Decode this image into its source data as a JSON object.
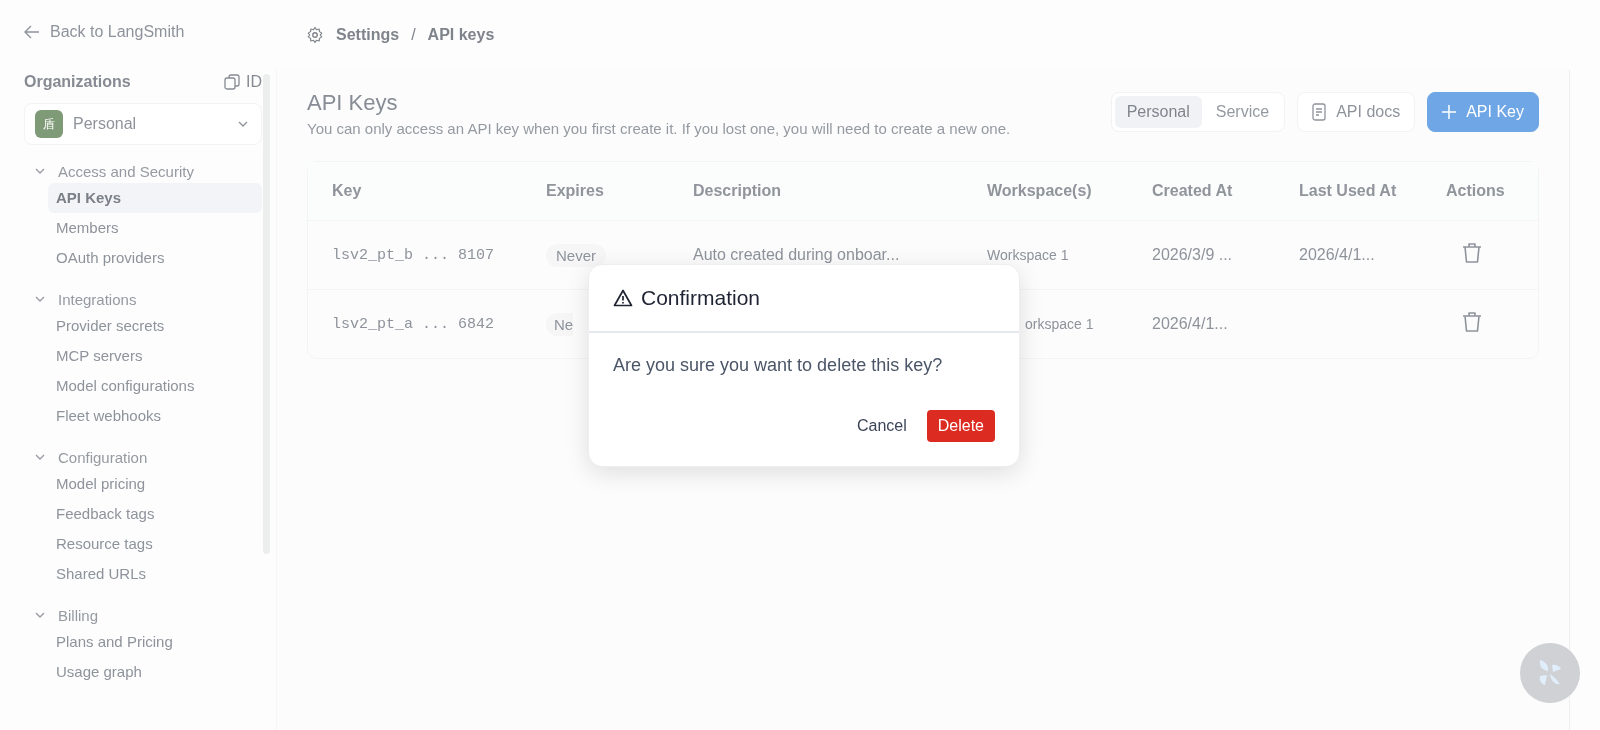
{
  "sidebar": {
    "back_link": "Back to LangSmith",
    "organizations_label": "Organizations",
    "id_label": "ID",
    "org_select": {
      "avatar": "盾",
      "value": "Personal"
    },
    "sections": [
      {
        "title": "Access and Security",
        "expanded": true,
        "items": [
          {
            "label": "API Keys",
            "selected": true
          },
          {
            "label": "Members",
            "selected": false
          },
          {
            "label": "OAuth providers",
            "selected": false
          }
        ]
      },
      {
        "title": "Integrations",
        "expanded": true,
        "items": [
          {
            "label": "Provider secrets",
            "selected": false
          },
          {
            "label": "MCP servers",
            "selected": false
          },
          {
            "label": "Model configurations",
            "selected": false
          },
          {
            "label": "Fleet webhooks",
            "selected": false
          }
        ]
      },
      {
        "title": "Configuration",
        "expanded": true,
        "items": [
          {
            "label": "Model pricing",
            "selected": false
          },
          {
            "label": "Feedback tags",
            "selected": false
          },
          {
            "label": "Resource tags",
            "selected": false
          },
          {
            "label": "Shared URLs",
            "selected": false
          }
        ]
      },
      {
        "title": "Billing",
        "expanded": true,
        "items": [
          {
            "label": "Plans and Pricing",
            "selected": false
          },
          {
            "label": "Usage graph",
            "selected": false
          }
        ]
      }
    ]
  },
  "breadcrumb": {
    "items": [
      "Settings",
      "API keys"
    ],
    "separator": "/"
  },
  "page": {
    "title": "API Keys",
    "subtitle": "You can only access an API key when you first create it. If you lost one, you will need to create a new one.",
    "key_type_toggle": [
      {
        "label": "Personal",
        "selected": true
      },
      {
        "label": "Service",
        "selected": false
      }
    ],
    "docs_button": "API docs",
    "add_button": "API Key"
  },
  "table": {
    "columns": [
      "Key",
      "Expires",
      "Description",
      "Workspace(s)",
      "Created At",
      "Last Used At",
      "Actions"
    ],
    "rows": [
      {
        "key": "lsv2_pt_b ... 8107",
        "expires": "Never",
        "description": "Auto created during onboar...",
        "workspace": "Workspace 1",
        "created_at": "2026/3/9 ...",
        "last_used_at": "2026/4/1..."
      },
      {
        "key": "lsv2_pt_a ... 6842",
        "expires": "Ne",
        "workspace": "orkspace 1",
        "created_at": "2026/4/1..."
      }
    ]
  },
  "dialog": {
    "title": "Confirmation",
    "message": "Are you sure you want to delete this key?",
    "cancel_button": "Cancel",
    "delete_button": "Delete"
  }
}
